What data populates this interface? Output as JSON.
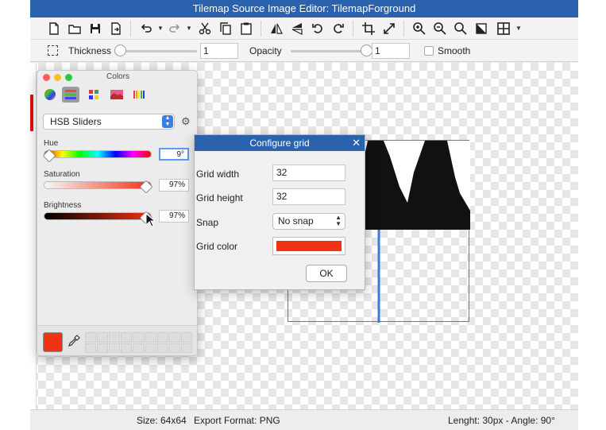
{
  "window": {
    "title": "Tilemap Source Image Editor: TilemapForground"
  },
  "toolbar": {
    "icons": [
      "new-file",
      "open-folder",
      "save",
      "export",
      "undo",
      "redo",
      "cut",
      "copy",
      "paste",
      "flip-horizontal",
      "flip-vertical",
      "rotate-left",
      "rotate-right",
      "crop",
      "resize",
      "zoom-in",
      "zoom-out",
      "zoom-fit",
      "fill",
      "grid"
    ]
  },
  "options": {
    "thickness_label": "Thickness",
    "thickness_value": "1",
    "thickness_level": 0,
    "opacity_label": "Opacity",
    "opacity_value": "1",
    "opacity_level": 1,
    "smooth_label": "Smooth",
    "smooth_checked": false
  },
  "colors_panel": {
    "title": "Colors",
    "mode": "HSB Sliders",
    "hue_label": "Hue",
    "hue_value": "9°",
    "saturation_label": "Saturation",
    "saturation_value": "97%",
    "brightness_label": "Brightness",
    "brightness_value": "97%",
    "current_color": "#f03215"
  },
  "dialog": {
    "title": "Configure grid",
    "close": "✕",
    "grid_width_label": "Grid width",
    "grid_width_value": "32",
    "grid_height_label": "Grid height",
    "grid_height_value": "32",
    "snap_label": "Snap",
    "snap_value": "No snap",
    "grid_color_label": "Grid color",
    "grid_color": "#f03215",
    "ok_label": "OK"
  },
  "status": {
    "size": "Size: 64x64",
    "export_format": "Export Format: PNG",
    "line_info": "Lenght: 30px - Angle: 90°"
  },
  "colors": {
    "title_bar": "#2a62ae",
    "accent": "#3b7fe0",
    "guide_line": "#3d7bd9"
  }
}
